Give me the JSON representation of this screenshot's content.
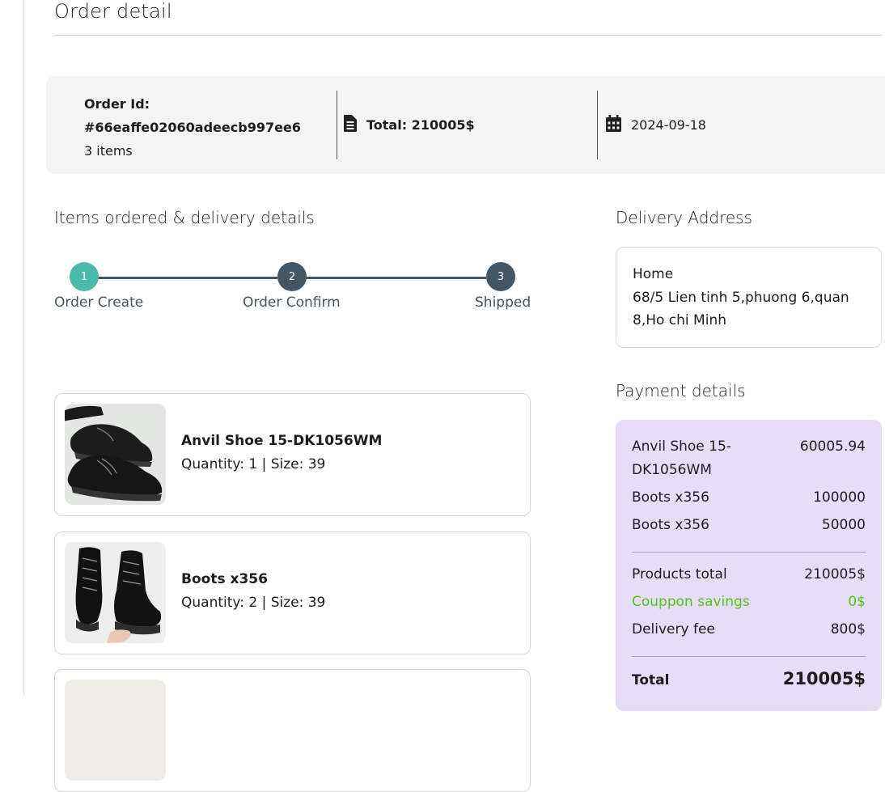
{
  "page": {
    "title": "Order detail"
  },
  "summary": {
    "order_id_label": "Order Id:",
    "order_id": "#66eaffe02060adeecb997ee6",
    "items_count": "3 items",
    "total": "Total: 210005$",
    "date": "2024-09-18"
  },
  "items_section": {
    "title": "Items ordered & delivery details"
  },
  "steps": [
    {
      "number": "1",
      "label": "Order Create",
      "state": "done",
      "color": "#4dbaa9"
    },
    {
      "number": "2",
      "label": "Order Confirm",
      "state": "pending",
      "color": "#455561"
    },
    {
      "number": "3",
      "label": "Shipped",
      "state": "pending",
      "color": "#455561"
    }
  ],
  "items": [
    {
      "name": "Anvil Shoe 15-DK1056WM",
      "meta": "Quantity: 1 | Size: 39",
      "image": "black-derby-shoes"
    },
    {
      "name": "Boots x356",
      "meta": "Quantity: 2 | Size: 39",
      "image": "black-lace-up-boots"
    },
    {
      "name": "",
      "meta": "",
      "image": "light-product-photo"
    }
  ],
  "delivery": {
    "title": "Delivery Address",
    "label": "Home",
    "address": "68/5 Lien tinh 5,phuong 6,quan 8,Ho chi Minh"
  },
  "payment": {
    "title": "Payment details",
    "lines": [
      {
        "name": "Anvil Shoe 15-DK1056WM",
        "amount": "60005.94"
      },
      {
        "name": "Boots x356",
        "amount": "100000"
      },
      {
        "name": "Boots x356",
        "amount": "50000"
      }
    ],
    "products_total_label": "Products total",
    "products_total": "210005$",
    "coupon_label": "Couppon savings",
    "coupon": "0$",
    "delivery_fee_label": "Delivery fee",
    "delivery_fee": "800$",
    "total_label": "Total",
    "total": "210005$"
  },
  "colors": {
    "coupon_green": "#52c41a",
    "payment_bg": "#e7ddf8",
    "summary_bg": "#f4f4f4"
  }
}
